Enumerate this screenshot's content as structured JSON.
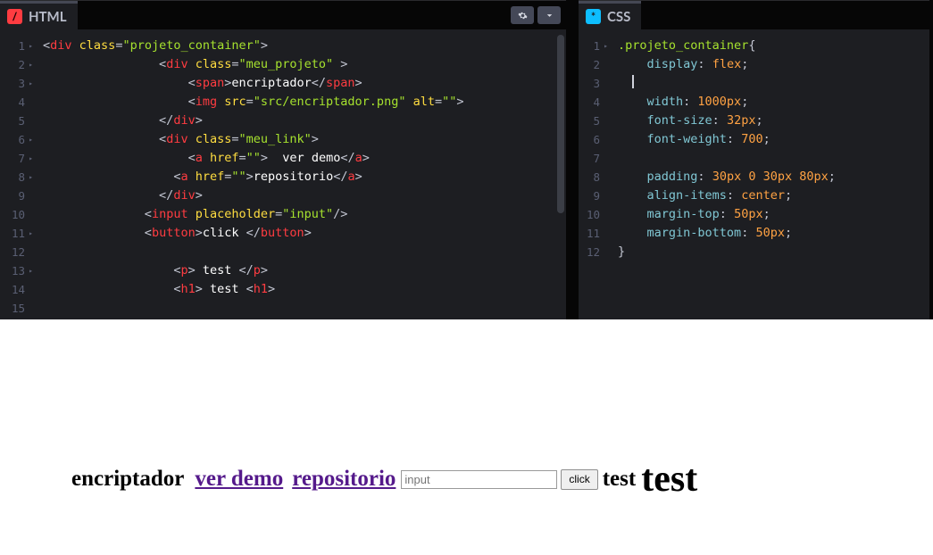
{
  "panels": {
    "html": {
      "title": "HTML",
      "badge": "/",
      "badge_color": "#ff3c41",
      "lines": [
        {
          "n": "1",
          "fold": true,
          "indent": 0,
          "tokens": [
            [
              "punct",
              "<"
            ],
            [
              "tagname",
              "div"
            ],
            [
              "punct",
              " "
            ],
            [
              "attr",
              "class"
            ],
            [
              "punct",
              "="
            ],
            [
              "val",
              "\"projeto_container\""
            ],
            [
              "punct",
              ">"
            ]
          ]
        },
        {
          "n": "2",
          "fold": true,
          "indent": 16,
          "tokens": [
            [
              "punct",
              "<"
            ],
            [
              "tagname",
              "div"
            ],
            [
              "punct",
              " "
            ],
            [
              "attr",
              "class"
            ],
            [
              "punct",
              "="
            ],
            [
              "val",
              "\"meu_projeto\""
            ],
            [
              "punct",
              " >"
            ]
          ]
        },
        {
          "n": "3",
          "fold": true,
          "indent": 20,
          "tokens": [
            [
              "punct",
              "<"
            ],
            [
              "tagname",
              "span"
            ],
            [
              "punct",
              ">"
            ],
            [
              "plain",
              "encriptador"
            ],
            [
              "punct",
              "</"
            ],
            [
              "tagname",
              "span"
            ],
            [
              "punct",
              ">"
            ]
          ]
        },
        {
          "n": "4",
          "fold": false,
          "indent": 20,
          "tokens": [
            [
              "punct",
              "<"
            ],
            [
              "tagname",
              "img"
            ],
            [
              "punct",
              " "
            ],
            [
              "attr",
              "src"
            ],
            [
              "punct",
              "="
            ],
            [
              "val",
              "\"src/encriptador.png\""
            ],
            [
              "punct",
              " "
            ],
            [
              "attr",
              "alt"
            ],
            [
              "punct",
              "="
            ],
            [
              "val",
              "\"\""
            ],
            [
              "punct",
              ">"
            ]
          ]
        },
        {
          "n": "5",
          "fold": false,
          "indent": 16,
          "tokens": [
            [
              "punct",
              "</"
            ],
            [
              "tagname",
              "div"
            ],
            [
              "punct",
              ">"
            ]
          ]
        },
        {
          "n": "6",
          "fold": true,
          "indent": 16,
          "tokens": [
            [
              "punct",
              "<"
            ],
            [
              "tagname",
              "div"
            ],
            [
              "punct",
              " "
            ],
            [
              "attr",
              "class"
            ],
            [
              "punct",
              "="
            ],
            [
              "val",
              "\"meu_link\""
            ],
            [
              "punct",
              ">"
            ]
          ]
        },
        {
          "n": "7",
          "fold": true,
          "indent": 20,
          "tokens": [
            [
              "punct",
              "<"
            ],
            [
              "tagname",
              "a"
            ],
            [
              "punct",
              " "
            ],
            [
              "attr",
              "href"
            ],
            [
              "punct",
              "="
            ],
            [
              "val",
              "\"\""
            ],
            [
              "punct",
              ">"
            ],
            [
              "plain",
              "  ver demo"
            ],
            [
              "punct",
              "</"
            ],
            [
              "tagname",
              "a"
            ],
            [
              "punct",
              ">"
            ]
          ]
        },
        {
          "n": "8",
          "fold": true,
          "indent": 18,
          "tokens": [
            [
              "punct",
              "<"
            ],
            [
              "tagname",
              "a"
            ],
            [
              "punct",
              " "
            ],
            [
              "attr",
              "href"
            ],
            [
              "punct",
              "="
            ],
            [
              "val",
              "\"\""
            ],
            [
              "punct",
              ">"
            ],
            [
              "plain",
              "repositorio"
            ],
            [
              "punct",
              "</"
            ],
            [
              "tagname",
              "a"
            ],
            [
              "punct",
              ">"
            ]
          ]
        },
        {
          "n": "9",
          "fold": false,
          "indent": 16,
          "tokens": [
            [
              "punct",
              "</"
            ],
            [
              "tagname",
              "div"
            ],
            [
              "punct",
              ">"
            ]
          ]
        },
        {
          "n": "10",
          "fold": false,
          "indent": 14,
          "tokens": [
            [
              "punct",
              "<"
            ],
            [
              "tagname",
              "input"
            ],
            [
              "punct",
              " "
            ],
            [
              "attr",
              "placeholder"
            ],
            [
              "punct",
              "="
            ],
            [
              "val",
              "\"input\""
            ],
            [
              "punct",
              "/>"
            ]
          ]
        },
        {
          "n": "11",
          "fold": true,
          "indent": 14,
          "tokens": [
            [
              "punct",
              "<"
            ],
            [
              "tagname",
              "button"
            ],
            [
              "punct",
              ">"
            ],
            [
              "plain",
              "click "
            ],
            [
              "punct",
              "</"
            ],
            [
              "tagname",
              "button"
            ],
            [
              "punct",
              ">"
            ]
          ]
        },
        {
          "n": "12",
          "fold": false,
          "indent": 0,
          "tokens": []
        },
        {
          "n": "13",
          "fold": true,
          "indent": 18,
          "tokens": [
            [
              "punct",
              "<"
            ],
            [
              "tagname",
              "p"
            ],
            [
              "punct",
              ">"
            ],
            [
              "plain",
              " test "
            ],
            [
              "punct",
              "</"
            ],
            [
              "tagname",
              "p"
            ],
            [
              "punct",
              ">"
            ]
          ]
        },
        {
          "n": "14",
          "fold": false,
          "indent": 18,
          "tokens": [
            [
              "punct",
              "<"
            ],
            [
              "tagname",
              "h1"
            ],
            [
              "punct",
              ">"
            ],
            [
              "plain",
              " test "
            ],
            [
              "punct",
              "<"
            ],
            [
              "tagname",
              "h1"
            ],
            [
              "punct",
              ">"
            ]
          ]
        },
        {
          "n": "15",
          "fold": false,
          "indent": 0,
          "tokens": []
        }
      ]
    },
    "css": {
      "title": "CSS",
      "badge": "*",
      "badge_color": "#0ebeff",
      "lines": [
        {
          "n": "1",
          "fold": true,
          "indent": 0,
          "tokens": [
            [
              "sel",
              ".projeto_container"
            ],
            [
              "punct",
              "{"
            ]
          ]
        },
        {
          "n": "2",
          "fold": false,
          "indent": 4,
          "tokens": [
            [
              "prop",
              "display"
            ],
            [
              "punct",
              ": "
            ],
            [
              "kw",
              "flex"
            ],
            [
              "punct",
              ";"
            ]
          ]
        },
        {
          "n": "3",
          "fold": false,
          "indent": 2,
          "tokens": [
            [
              "cursor",
              ""
            ]
          ]
        },
        {
          "n": "4",
          "fold": false,
          "indent": 4,
          "tokens": [
            [
              "prop",
              "width"
            ],
            [
              "punct",
              ": "
            ],
            [
              "num",
              "1000px"
            ],
            [
              "punct",
              ";"
            ]
          ]
        },
        {
          "n": "5",
          "fold": false,
          "indent": 4,
          "tokens": [
            [
              "prop",
              "font-size"
            ],
            [
              "punct",
              ": "
            ],
            [
              "num",
              "32px"
            ],
            [
              "punct",
              ";"
            ]
          ]
        },
        {
          "n": "6",
          "fold": false,
          "indent": 4,
          "tokens": [
            [
              "prop",
              "font-weight"
            ],
            [
              "punct",
              ": "
            ],
            [
              "num",
              "700"
            ],
            [
              "punct",
              ";"
            ]
          ]
        },
        {
          "n": "7",
          "fold": false,
          "indent": 0,
          "tokens": []
        },
        {
          "n": "8",
          "fold": false,
          "indent": 4,
          "tokens": [
            [
              "prop",
              "padding"
            ],
            [
              "punct",
              ": "
            ],
            [
              "num",
              "30px"
            ],
            [
              "punct",
              " "
            ],
            [
              "num",
              "0"
            ],
            [
              "punct",
              " "
            ],
            [
              "num",
              "30px"
            ],
            [
              "punct",
              " "
            ],
            [
              "num",
              "80px"
            ],
            [
              "punct",
              ";"
            ]
          ]
        },
        {
          "n": "9",
          "fold": false,
          "indent": 4,
          "tokens": [
            [
              "prop",
              "align-items"
            ],
            [
              "punct",
              ": "
            ],
            [
              "kw",
              "center"
            ],
            [
              "punct",
              ";"
            ]
          ]
        },
        {
          "n": "10",
          "fold": false,
          "indent": 4,
          "tokens": [
            [
              "prop",
              "margin-top"
            ],
            [
              "punct",
              ": "
            ],
            [
              "num",
              "50px"
            ],
            [
              "punct",
              ";"
            ]
          ]
        },
        {
          "n": "11",
          "fold": false,
          "indent": 4,
          "tokens": [
            [
              "prop",
              "margin-bottom"
            ],
            [
              "punct",
              ": "
            ],
            [
              "num",
              "50px"
            ],
            [
              "punct",
              ";"
            ]
          ]
        },
        {
          "n": "12",
          "fold": false,
          "indent": 0,
          "tokens": [
            [
              "punct",
              "}"
            ]
          ]
        }
      ]
    }
  },
  "preview": {
    "span_text": "encriptador",
    "link1": "ver demo",
    "link2": "repositorio",
    "input_placeholder": "input",
    "button_label": "click",
    "p_text": "test",
    "h1_text": "test"
  }
}
